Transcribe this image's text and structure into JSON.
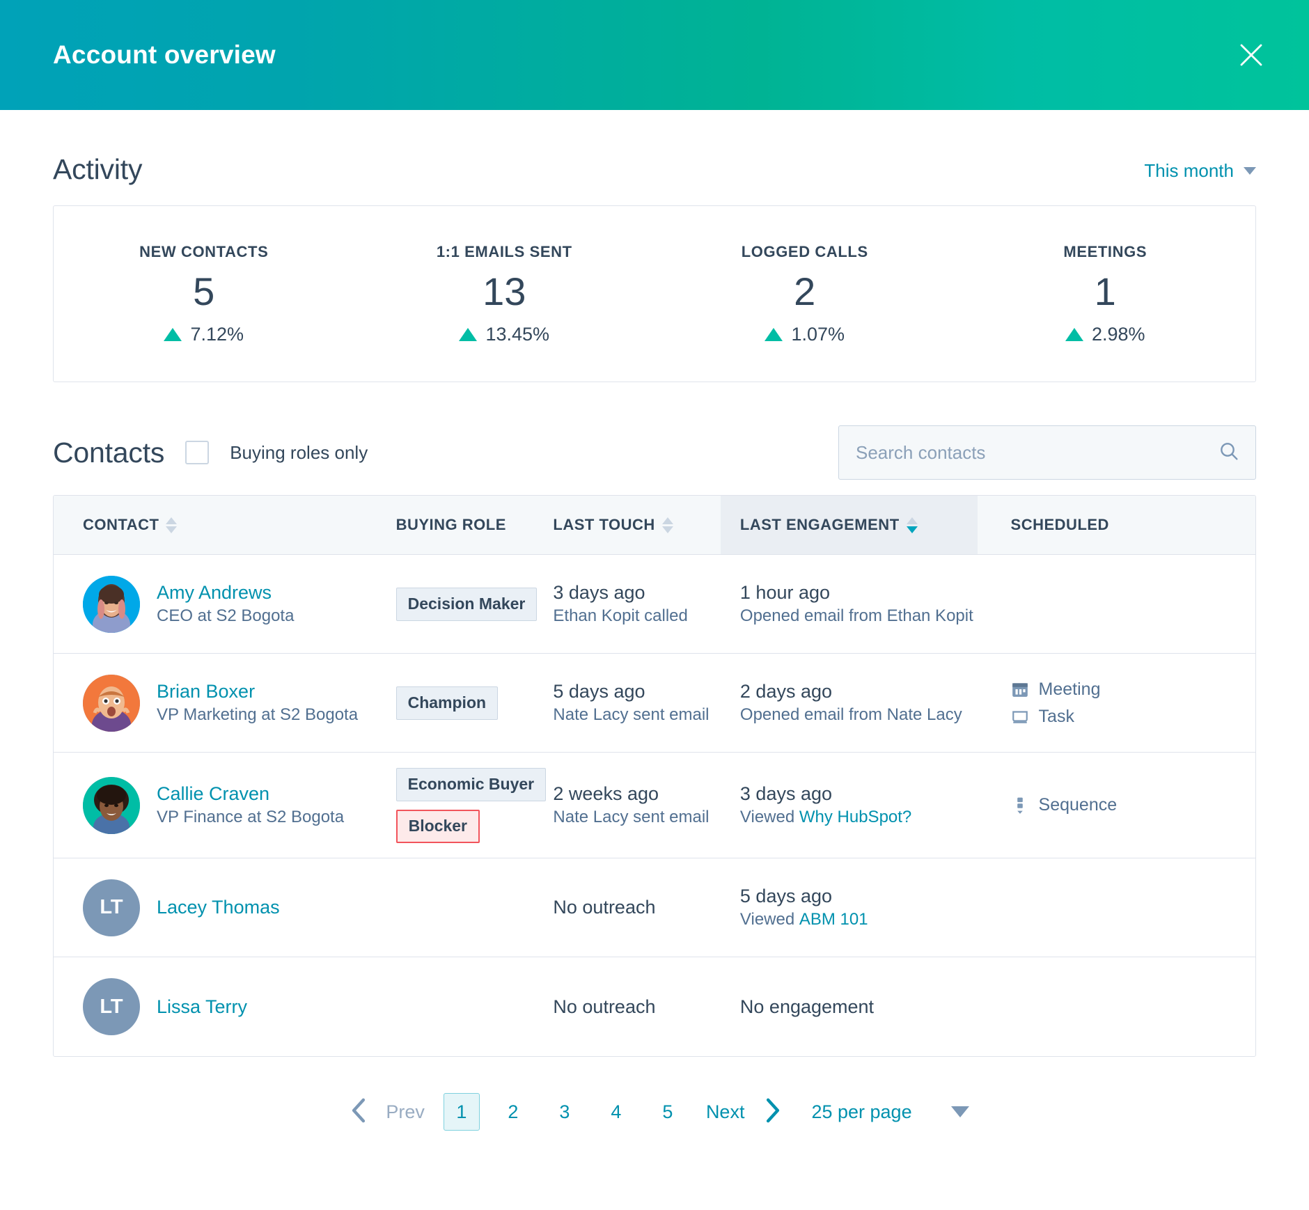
{
  "header": {
    "title": "Account overview",
    "close_icon": "close-icon"
  },
  "activity": {
    "title": "Activity",
    "range_label": "This month",
    "range_caret_icon": "chevron-down-icon",
    "stats": [
      {
        "label": "NEW CONTACTS",
        "value": "5",
        "delta": "7.12%",
        "trend": "up"
      },
      {
        "label": "1:1 EMAILS SENT",
        "value": "13",
        "delta": "13.45%",
        "trend": "up"
      },
      {
        "label": "LOGGED CALLS",
        "value": "2",
        "delta": "1.07%",
        "trend": "up"
      },
      {
        "label": "MEETINGS",
        "value": "1",
        "delta": "2.98%",
        "trend": "up"
      }
    ]
  },
  "contacts": {
    "title": "Contacts",
    "buying_roles_only_label": "Buying roles only",
    "buying_roles_only_checked": false,
    "search": {
      "placeholder": "Search contacts",
      "value": "",
      "icon": "search-icon"
    },
    "columns": [
      {
        "label": "CONTACT",
        "sortable": true,
        "sorted": false,
        "direction": "none"
      },
      {
        "label": "BUYING ROLE",
        "sortable": false,
        "sorted": false,
        "direction": "none"
      },
      {
        "label": "LAST TOUCH",
        "sortable": true,
        "sorted": false,
        "direction": "none"
      },
      {
        "label": "LAST ENGAGEMENT",
        "sortable": true,
        "sorted": true,
        "direction": "desc"
      },
      {
        "label": "SCHEDULED",
        "sortable": false,
        "sorted": false,
        "direction": "none"
      }
    ],
    "rows": [
      {
        "name": "Amy Andrews",
        "subtitle": "CEO at S2 Bogota",
        "avatar_type": "photo",
        "avatar_initials": "",
        "avatar_color": "#00a4e4",
        "roles": [
          {
            "label": "Decision Maker",
            "style": "default"
          }
        ],
        "last_touch_main": "3 days ago",
        "last_touch_sub": "Ethan Kopit called",
        "last_engagement_main": "1 hour ago",
        "last_engagement_sub_prefix": "Opened email from Ethan Kopit",
        "last_engagement_link": "",
        "scheduled": []
      },
      {
        "name": "Brian Boxer",
        "subtitle": "VP Marketing at S2 Bogota",
        "avatar_type": "photo",
        "avatar_initials": "",
        "avatar_color": "#f2783c",
        "roles": [
          {
            "label": "Champion",
            "style": "default"
          }
        ],
        "last_touch_main": "5 days ago",
        "last_touch_sub": "Nate Lacy sent email",
        "last_engagement_main": "2 days ago",
        "last_engagement_sub_prefix": "Opened email from Nate Lacy",
        "last_engagement_link": "",
        "scheduled": [
          {
            "label": "Meeting",
            "icon": "calendar-icon"
          },
          {
            "label": "Task",
            "icon": "task-icon"
          }
        ]
      },
      {
        "name": "Callie Craven",
        "subtitle": "VP Finance at S2 Bogota",
        "avatar_type": "photo",
        "avatar_initials": "",
        "avatar_color": "#00bda5",
        "roles": [
          {
            "label": "Economic Buyer",
            "style": "default"
          },
          {
            "label": "Blocker",
            "style": "blocker"
          }
        ],
        "last_touch_main": "2 weeks ago",
        "last_touch_sub": "Nate Lacy sent email",
        "last_engagement_main": "3 days ago",
        "last_engagement_sub_prefix": "Viewed ",
        "last_engagement_link": "Why HubSpot?",
        "scheduled": [
          {
            "label": "Sequence",
            "icon": "sequence-icon"
          }
        ]
      },
      {
        "name": "Lacey Thomas",
        "subtitle": "",
        "avatar_type": "initials",
        "avatar_initials": "LT",
        "avatar_color": "#7c98b6",
        "roles": [],
        "last_touch_main": "No outreach",
        "last_touch_sub": "",
        "last_engagement_main": "5 days ago",
        "last_engagement_sub_prefix": "Viewed ",
        "last_engagement_link": "ABM 101",
        "scheduled": []
      },
      {
        "name": "Lissa Terry",
        "subtitle": "",
        "avatar_type": "initials",
        "avatar_initials": "LT",
        "avatar_color": "#7c98b6",
        "roles": [],
        "last_touch_main": "No outreach",
        "last_touch_sub": "",
        "last_engagement_main": "No engagement",
        "last_engagement_sub_prefix": "",
        "last_engagement_link": "",
        "scheduled": []
      }
    ]
  },
  "pagination": {
    "prev_label": "Prev",
    "next_label": "Next",
    "pages": [
      "1",
      "2",
      "3",
      "4",
      "5"
    ],
    "current_page": "1",
    "per_page_label": "25 per page",
    "prev_icon": "chevron-left-icon",
    "next_icon": "chevron-right-icon",
    "per_page_caret_icon": "chevron-down-icon"
  },
  "colors": {
    "brand_teal": "#00a4bd",
    "accent_green": "#00bda5",
    "text_dark": "#33475b",
    "text_muted": "#516f90",
    "link": "#0091ae",
    "danger": "#f2545b",
    "border": "#dfe3eb"
  }
}
